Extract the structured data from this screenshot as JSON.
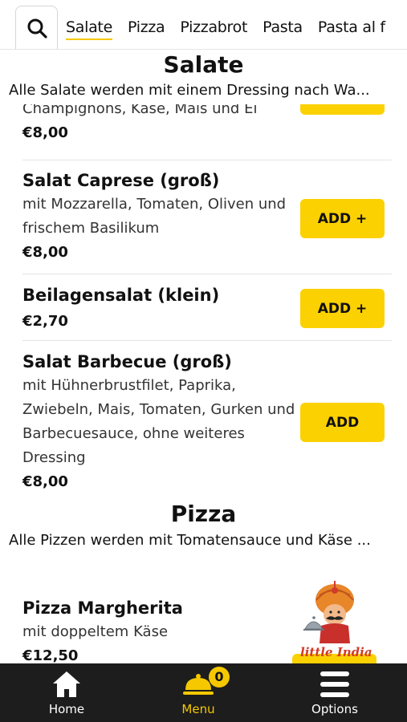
{
  "tabs": [
    "Salate",
    "Pizza",
    "Pizzabrot",
    "Pasta",
    "Pasta al f"
  ],
  "sections": {
    "salate": {
      "title": "Salate",
      "description": "Alle Salate werden mit einem Dressing nach Wa..."
    },
    "pizza": {
      "title": "Pizza",
      "description": "Alle Pizzen werden mit Tomatensauce und Käse ..."
    }
  },
  "items": [
    {
      "name": "",
      "desc": "Champignons, Käse, Mais und Ei",
      "price": "€8,00",
      "button": ""
    },
    {
      "name": "Salat Caprese (groß)",
      "desc": "mit Mozzarella, Tomaten, Oliven und frischem Basilikum",
      "price": "€8,00",
      "button": "ADD +"
    },
    {
      "name": "Beilagensalat (klein)",
      "desc": "",
      "price": "€2,70",
      "button": "ADD +"
    },
    {
      "name": "Salat Barbecue (groß)",
      "desc": "mit Hühnerbrustfilet, Paprika, Zwiebeln, Mais, Tomaten, Gurken und Barbecuesauce, ohne weiteres Dressing",
      "price": "€8,00",
      "button": "ADD"
    },
    {
      "name": "Pizza Margherita",
      "desc": "mit doppeltem Käse",
      "price": "€12,50",
      "button": ""
    }
  ],
  "logo_text": "little India",
  "nav": {
    "home": "Home",
    "menu": "Menu",
    "options": "Options",
    "cart_count": "0"
  },
  "colors": {
    "accent": "#fcd102",
    "nav_bg": "#1d1d1d"
  }
}
